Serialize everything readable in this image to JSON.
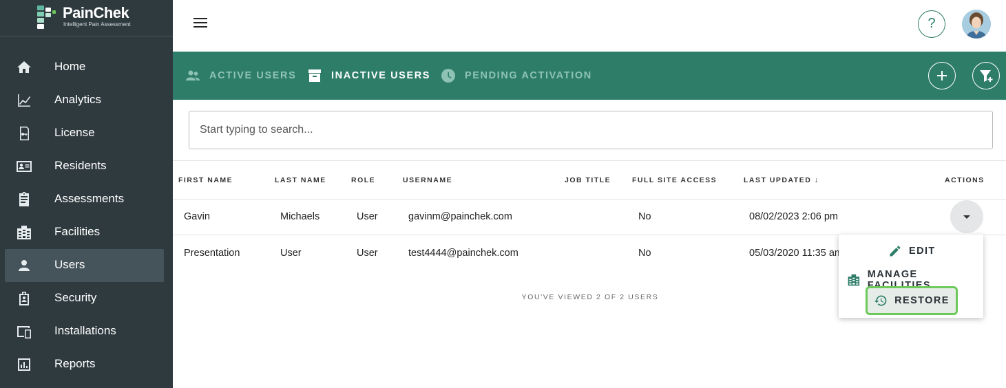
{
  "brand": {
    "name": "PainChek",
    "tagline": "Intelligent Pain Assessment"
  },
  "sidebar": {
    "items": [
      {
        "label": "Home",
        "icon": "home-icon"
      },
      {
        "label": "Analytics",
        "icon": "analytics-icon"
      },
      {
        "label": "License",
        "icon": "license-icon"
      },
      {
        "label": "Residents",
        "icon": "residents-icon"
      },
      {
        "label": "Assessments",
        "icon": "assessments-icon"
      },
      {
        "label": "Facilities",
        "icon": "facilities-icon"
      },
      {
        "label": "Users",
        "icon": "users-icon",
        "active": true
      },
      {
        "label": "Security",
        "icon": "security-icon"
      },
      {
        "label": "Installations",
        "icon": "installations-icon"
      },
      {
        "label": "Reports",
        "icon": "reports-icon"
      }
    ]
  },
  "topbar": {
    "help_label": "?"
  },
  "tabs": [
    {
      "label": "ACTIVE USERS",
      "icon": "people-icon",
      "active": false
    },
    {
      "label": "INACTIVE USERS",
      "icon": "archive-icon",
      "active": true
    },
    {
      "label": "PENDING ACTIVATION",
      "icon": "clock-icon",
      "active": false
    }
  ],
  "search": {
    "placeholder": "Start typing to search..."
  },
  "table": {
    "columns": [
      "FIRST NAME",
      "LAST NAME",
      "ROLE",
      "USERNAME",
      "JOB TITLE",
      "FULL SITE ACCESS",
      "LAST UPDATED ↓",
      "ACTIONS"
    ],
    "rows": [
      {
        "first": "Gavin",
        "last": "Michaels",
        "role": "User",
        "username": "gavinm@painchek.com",
        "job": "",
        "access": "No",
        "updated": "08/02/2023 2:06 pm"
      },
      {
        "first": "Presentation",
        "last": "User",
        "role": "User",
        "username": "test4444@painchek.com",
        "job": "",
        "access": "No",
        "updated": "05/03/2020 11:35 am"
      }
    ],
    "footer": "YOU'VE VIEWED 2 OF 2 USERS"
  },
  "menu": {
    "edit": "EDIT",
    "manage": "MANAGE FACILITIES",
    "restore": "RESTORE"
  },
  "colors": {
    "sidebar": "#2f3a3f",
    "accent": "#2e7d69",
    "highlight": "#6cc95a"
  }
}
